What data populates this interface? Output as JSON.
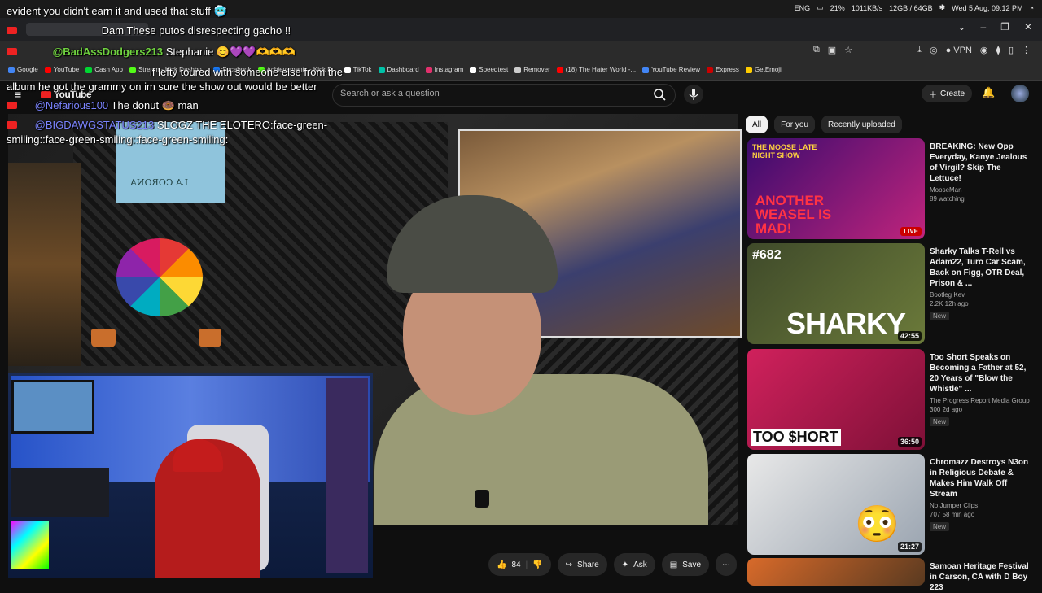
{
  "system": {
    "lang": "ENG",
    "battery": "21%",
    "net": "1011KB/s",
    "ram": "12GB / 64GB",
    "datetime": "Wed 5 Aug, 09:12 PM"
  },
  "browser": {
    "vpn_label": "VPN",
    "bookmarks": [
      {
        "label": "Google",
        "color": "#4285f4"
      },
      {
        "label": "YouTube",
        "color": "#ff0000"
      },
      {
        "label": "Cash App",
        "color": "#00d632"
      },
      {
        "label": "Stream - Kick Dashbo...",
        "color": "#53fc18"
      },
      {
        "label": "Facebook",
        "color": "#1877f2"
      },
      {
        "label": "Achievements - Kick D...",
        "color": "#53fc18"
      },
      {
        "label": "TikTok",
        "color": "#ffffff"
      },
      {
        "label": "Dashboard",
        "color": "#00c2a8"
      },
      {
        "label": "Instagram",
        "color": "#e1306c"
      },
      {
        "label": "Speedtest",
        "color": "#ffffff"
      },
      {
        "label": "Remover",
        "color": "#cccccc"
      },
      {
        "label": "(18) The Hater World -...",
        "color": "#ff0000"
      },
      {
        "label": "YouTube Review",
        "color": "#4285f4"
      },
      {
        "label": "Express",
        "color": "#cc0000"
      },
      {
        "label": "GetEmoji",
        "color": "#ffcc00"
      }
    ]
  },
  "youtube": {
    "logo_text": "YouTube",
    "search_placeholder": "Search or ask a question",
    "create_label": "Create"
  },
  "chat": [
    {
      "user": "",
      "message": "evident you didn't earn it and used that stuff 🥶"
    },
    {
      "user": "",
      "message": "Dam These putos disrespecting gacho !!"
    },
    {
      "user": "@BadAssDodgers213",
      "message": "Stephanie 😊💜💜🫶🫶🫶"
    },
    {
      "user": "",
      "message": "if lefty toured with someone else from the album he got the grammy on im sure the show out would be better"
    },
    {
      "user": "@Nefarious100",
      "message": "The donut 🍩 man"
    },
    {
      "user": "@BIGDAWGSTATUS213",
      "message": "SLOGZ THE ELOTERO:face-green-smiling::face-green-smiling::face-green-smiling:"
    }
  ],
  "video_overlay": {
    "sign_text": "LA CORONA"
  },
  "actions": {
    "likes": "84",
    "share_label": "Share",
    "ask_label": "Ask",
    "save_label": "Save"
  },
  "chips": [
    "All",
    "For you",
    "Recently uploaded"
  ],
  "recommendations": [
    {
      "title": "BREAKING: New Opp Everyday, Kanye Jealous of Virgil? Skip The Lettuce!",
      "channel": "MooseMan",
      "views": "89 watching",
      "badge": "LIVE",
      "thumb_text": "ANOTHER WEASEL IS MAD!",
      "thumb_sub": "THE MOOSE LATE NIGHT SHOW",
      "thumb_colors": [
        "#3a0b6e",
        "#c0247c"
      ]
    },
    {
      "title": "Sharky Talks T-Rell vs Adam22, Turo Car Scam, Back on Figg, OTR Deal, Prison & ...",
      "channel": "Bootleg Kev",
      "views": "2.2K  12h ago",
      "new": "New",
      "duration": "42:55",
      "thumb_text": "SHARKY",
      "thumb_sub": "#682",
      "thumb_colors": [
        "#3f4a2a",
        "#6b7a3a"
      ]
    },
    {
      "title": "Too Short Speaks on Becoming a Father at 52, 20 Years of \"Blow the Whistle\" ...",
      "channel": "The Progress Report Media Group",
      "views": "300  2d ago",
      "new": "New",
      "duration": "36:50",
      "thumb_text": "TOO $HORT",
      "thumb_sub": "",
      "thumb_colors": [
        "#d0215c",
        "#7e1037"
      ]
    },
    {
      "title": "Chromazz Destroys N3on in Religious Debate & Makes Him Walk Off Stream",
      "channel": "No Jumper Clips",
      "views": "707  58 min ago",
      "new": "New",
      "duration": "21:27",
      "thumb_text": "😳",
      "thumb_sub": "",
      "thumb_colors": [
        "#e8e8e8",
        "#9aa4b0"
      ]
    },
    {
      "title": "Samoan Heritage Festival in Carson, CA with D Boy 223",
      "channel": "",
      "views": "",
      "duration": "",
      "thumb_text": "",
      "thumb_sub": "",
      "thumb_colors": [
        "#d86a2a",
        "#5a3a20"
      ]
    }
  ]
}
